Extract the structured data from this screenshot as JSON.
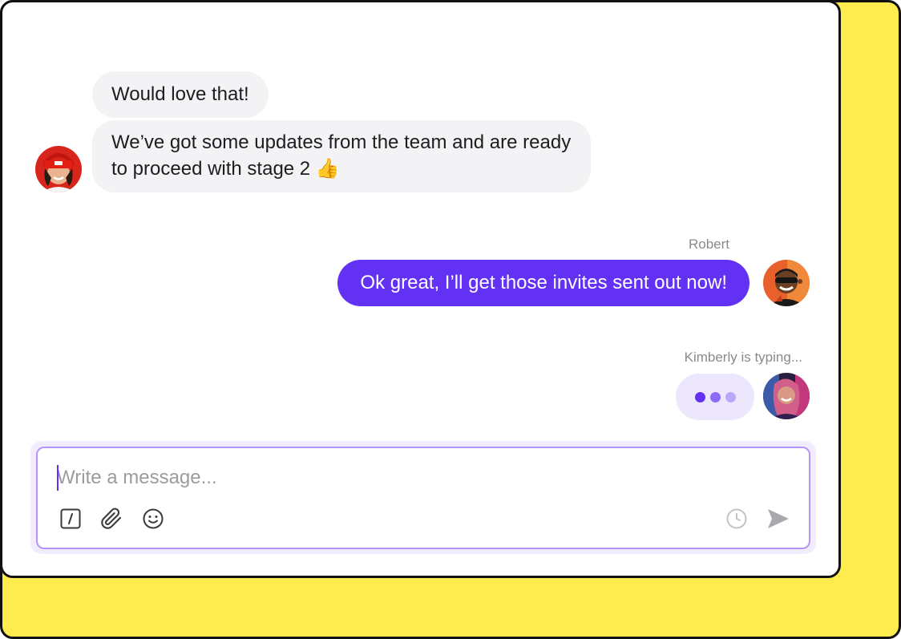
{
  "messages": [
    {
      "id": 1,
      "direction": "incoming",
      "text": "Would love that!"
    },
    {
      "id": 2,
      "direction": "incoming",
      "text": "We’ve got some updates from the team and are ready to proceed with stage 2 👍"
    },
    {
      "id": 3,
      "direction": "outgoing",
      "sender": "Robert",
      "text": "Ok great, I’ll get those invites sent out now!"
    }
  ],
  "typing": {
    "text": "Kimberly is typing..."
  },
  "composer": {
    "placeholder": "Write a message..."
  },
  "icons": {
    "slash": "slash-command-icon",
    "attach": "paperclip-icon",
    "emoji": "smiley-icon",
    "schedule": "clock-icon",
    "send": "send-arrow-icon"
  },
  "colors": {
    "accent": "#6331F4",
    "incoming_bubble": "#F3F3F5",
    "typing_bubble": "#EDE7FE",
    "composer_border": "#B397F8",
    "frame_yellow": "#FEEC4F",
    "typing_dots": [
      "#6331F4",
      "#8D6AF7",
      "#BBA6FA"
    ]
  }
}
